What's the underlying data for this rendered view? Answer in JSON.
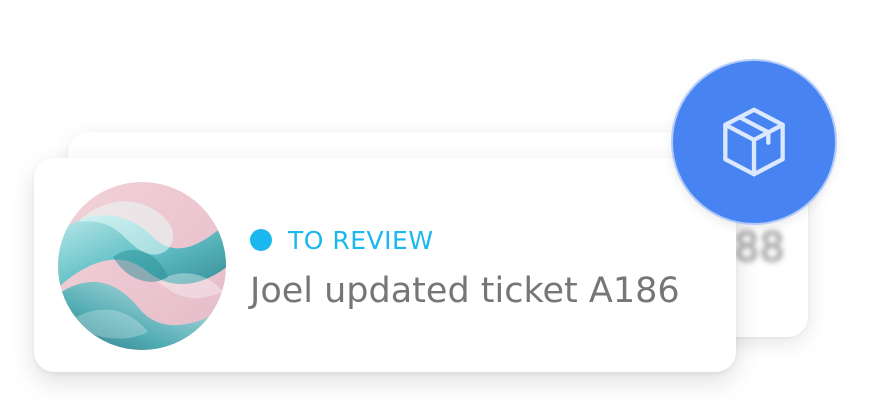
{
  "notification_back": {
    "partial_text": "88"
  },
  "notification": {
    "status": "TO REVIEW",
    "message": "Joel updated ticket A186",
    "status_color": "#1ab8ef",
    "message_color": "#767676",
    "avatar_icon": "abstract-glass-art-image"
  },
  "badge": {
    "icon": "package-box-icon",
    "color": "#4883f2"
  }
}
